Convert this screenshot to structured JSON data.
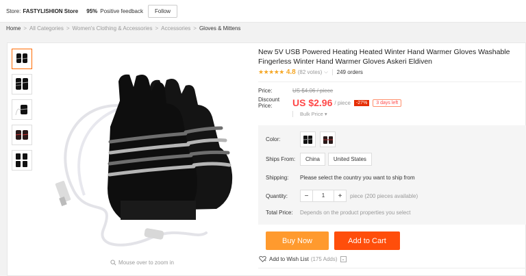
{
  "store": {
    "label": "Store:",
    "name": "FASTYLISHION Store",
    "feedback_pct": "95%",
    "feedback_label": "Positive feedback",
    "follow": "Follow"
  },
  "breadcrumb": {
    "home": "Home",
    "items": [
      "All Categories",
      "Women's Clothing & Accessories",
      "Accessories"
    ],
    "current": "Gloves & Mittens",
    "sep": ">"
  },
  "gallery": {
    "zoom_hint": "Mouse over to zoom in"
  },
  "product": {
    "title": "New 5V USB Powered Heating Heated Winter Hand Warmer Gloves Washable Fingerless Winter Hand Warmer Gloves Askeri Eldiven",
    "rating_stars": "★★★★★",
    "rating": "4.8",
    "votes": "(82 votes)",
    "orders": "249 orders",
    "price_label": "Price:",
    "old_price": "US $4.06 / piece",
    "discount_label": "Discount Price:",
    "new_price": "US $2.96",
    "per_piece": "/ piece",
    "off": "-27%",
    "days_left": "3 days left",
    "bulk_price": "Bulk Price ▾"
  },
  "options": {
    "color_label": "Color:",
    "ships_from_label": "Ships From:",
    "ships_from": [
      "China",
      "United States"
    ],
    "shipping_label": "Shipping:",
    "shipping_text": "Please select the country you want to ship from",
    "quantity_label": "Quantity:",
    "quantity_minus": "−",
    "quantity_value": "1",
    "quantity_plus": "+",
    "quantity_note": "piece (200 pieces available)",
    "total_label": "Total Price:",
    "total_text": "Depends on the product properties you select"
  },
  "actions": {
    "buy_now": "Buy Now",
    "add_to_cart": "Add to Cart",
    "wish": "Add to Wish List",
    "wish_count": "(175 Adds)"
  },
  "colors": {
    "accent_orange": "#ff9a2e",
    "cart_red": "#ff4e0b",
    "price_red": "#ff4747"
  }
}
